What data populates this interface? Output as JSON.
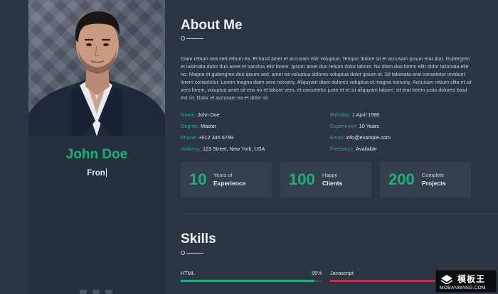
{
  "profile": {
    "name": "John Doe",
    "role_typed": "Fron"
  },
  "about": {
    "heading": "About Me",
    "paragraph": "Diam rebum sea stet rebum ea. Et kasd amet et accusam elitr voluptua. Tempor dolore sit et accusam ipsum erat duo. Gubergren et takimata dolor duo amet et sanctus elitr lorem. Ipsum amet duo rebum dolor labore. No diam duo lorem elitr dolor takimata elitr no. Magna et gubergren duo ipsum sed, amet ea voluptua dolores voluptua dolor ipsum et. Sit takimata erat consetetur invidunt lorem consetetur. Lorem magna diam vero nonumy. Aliquyam diam dolores voluptua et magna nonumy. Accusam rebum clita et sit vero lorem, voluptua amet sit eos no et labore vero, et consetetur justo et et sit aliquyam labore, sit erat lorem justo dolores kasd est sit. Dolor et accusam ea et dolor sit.",
    "info_left": [
      {
        "key": "Name:",
        "value": "John Doe"
      },
      {
        "key": "Degree:",
        "value": "Master"
      },
      {
        "key": "Phone:",
        "value": "+012 345 6789"
      },
      {
        "key": "Address:",
        "value": "123 Street, New York, USA"
      }
    ],
    "info_right": [
      {
        "key": "Birthday:",
        "value": "1 April 1990"
      },
      {
        "key": "Experience:",
        "value": "10 Years"
      },
      {
        "key": "Email:",
        "value": "info@example.com"
      },
      {
        "key": "Freelance:",
        "value": "Available"
      }
    ]
  },
  "stats": [
    {
      "number": "10",
      "line1": "Years of",
      "line2": "Experience"
    },
    {
      "number": "100",
      "line1": "Happy",
      "line2": "Clients"
    },
    {
      "number": "200",
      "line1": "Complete",
      "line2": "Projects"
    }
  ],
  "skills": {
    "heading": "Skills",
    "items": [
      {
        "label": "HTML",
        "percent_text": "95%",
        "level": 0.95,
        "color": "#19b37a"
      },
      {
        "label": "Javascript",
        "percent_text": "",
        "level": 0.85,
        "color": "#c0334d"
      }
    ]
  },
  "watermark": {
    "title": "模板王",
    "url": "MOBANWANG.COM"
  },
  "colors": {
    "accent": "#19b37a",
    "background": "#2b3543",
    "sidebar": "#25303d",
    "card": "#34404e"
  }
}
